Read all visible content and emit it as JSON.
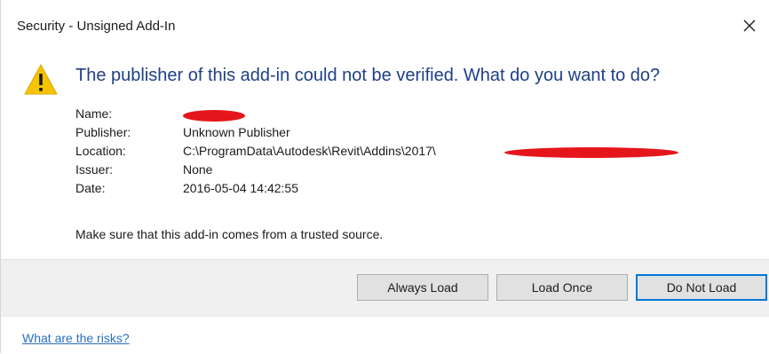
{
  "window": {
    "title": "Security - Unsigned Add-In",
    "close_glyph": "✕"
  },
  "icon": {
    "name": "warning-icon",
    "glyph": "!",
    "color": "#f5c400"
  },
  "headline": "The publisher of this add-in could not be verified. What do you want to do?",
  "details": {
    "name_label": "Name:",
    "name_value": "",
    "publisher_label": "Publisher:",
    "publisher_value": "Unknown Publisher",
    "location_label": "Location:",
    "location_value": "C:\\ProgramData\\Autodesk\\Revit\\Addins\\2017\\",
    "issuer_label": "Issuer:",
    "issuer_value": "None",
    "date_label": "Date:",
    "date_value": "2016-05-04 14:42:55"
  },
  "trust_note": "Make sure that this add-in comes from a trusted source.",
  "buttons": {
    "always_load": "Always Load",
    "load_once": "Load Once",
    "do_not_load": "Do Not Load"
  },
  "footer": {
    "risk_link": "What are the risks?"
  },
  "colors": {
    "headline": "#1f3f86",
    "link": "#2a6fc0",
    "focus_border": "#0078d7",
    "redaction": "#e5161b"
  }
}
